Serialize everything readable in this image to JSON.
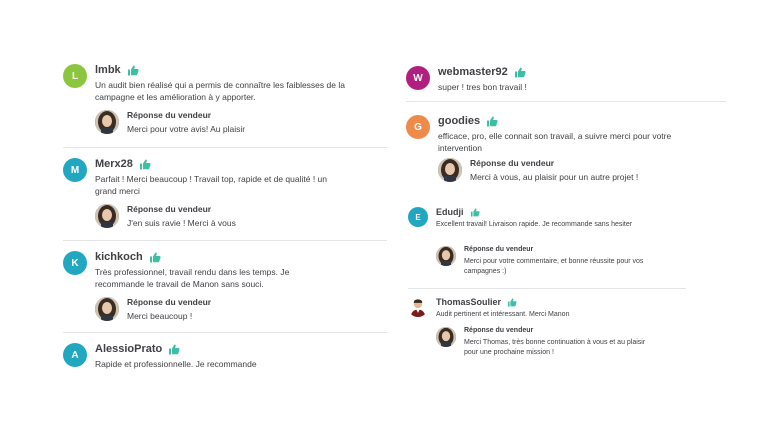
{
  "seller_reply_title": "Réponse du vendeur",
  "colors": {
    "thumb": "#3dbfa6",
    "divider": "#e4e5e7"
  },
  "left_reviews": [
    {
      "initial": "L",
      "name": "lmbk",
      "avatar_color": "#8cc63f",
      "text": "Un audit bien réalisé qui a permis de connaître les faiblesses de la campagne et les amélioration à y apporter.",
      "reply": "Merci pour votre avis! Au plaisir"
    },
    {
      "initial": "M",
      "name": "Merx28",
      "avatar_color": "#22a7c0",
      "text": "Parfait ! Merci beaucoup ! Travail top, rapide et de qualité ! un grand merci",
      "reply": "J'en suis ravie ! Merci à vous"
    },
    {
      "initial": "K",
      "name": "kichkoch",
      "avatar_color": "#22a7c0",
      "text": "Très professionnel, travail rendu dans les temps. Je recommande le travail de Manon sans souci.",
      "reply": "Merci beaucoup !"
    },
    {
      "initial": "A",
      "name": "AlessioPrato",
      "avatar_color": "#22a7c0",
      "text": "Rapide et professionnelle. Je recommande",
      "reply": ""
    }
  ],
  "right_reviews": [
    {
      "initial": "W",
      "name": "webmaster92",
      "avatar_color": "#b1207f",
      "text": "super ! tres bon travail !",
      "reply": ""
    },
    {
      "initial": "G",
      "name": "goodies",
      "avatar_color": "#ee8a4a",
      "text": "efficace, pro, elle connait son travail, a suivre merci pour votre intervention",
      "reply": "Merci à vous, au plaisir pour un autre projet !"
    },
    {
      "initial": "E",
      "name": "Edudji",
      "avatar_color": "#22a7c0",
      "text": "Excellent travail! Livraison rapide. Je recommande sans hesiter",
      "reply": "Merci pour votre commentaire, et bonne réussite pour vos campagnes :)"
    },
    {
      "initial": "",
      "name": "ThomasSoulier",
      "avatar_color": "#ffffff",
      "text": "Audit pertinent et intéressant. Merci Manon",
      "reply": "Merci Thomas, très bonne continuation à vous et au plaisir pour une prochaine mission !"
    }
  ]
}
